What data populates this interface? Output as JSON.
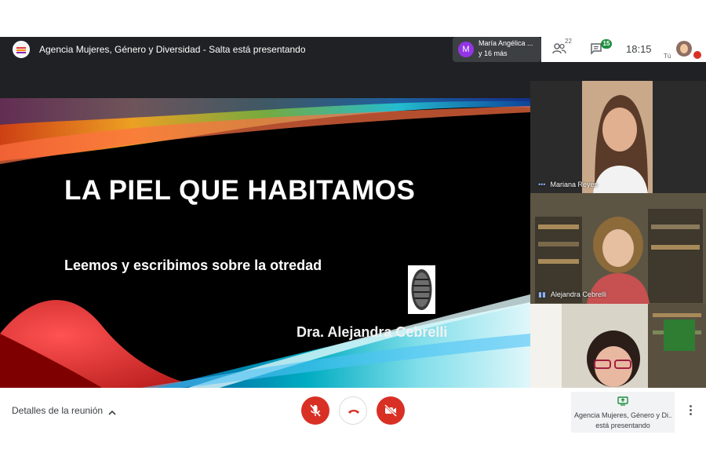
{
  "header": {
    "presenter_text": "Agencia Mujeres, Género y Diversidad - Salta está presentando",
    "join_notice": {
      "avatar_letter": "M",
      "name": "María Angélica ...",
      "more": "y 16 más"
    },
    "people_count": "22",
    "chat_badge": "15",
    "time": "18:15",
    "self_label": "Tú"
  },
  "slide": {
    "title": "LA PIEL QUE HABITAMOS",
    "subtitle": "Leemos y escribimos sobre la otredad",
    "author": "Dra. Alejandra Cebrelli"
  },
  "participants": [
    {
      "name": "Mariana Reyes"
    },
    {
      "name": "Alejandra Cebrelli"
    },
    {
      "name": ""
    }
  ],
  "footer": {
    "details_label": "Detalles de la reunión",
    "present_line1": "Agencia Mujeres, Género y Di...",
    "present_line2": "está presentando"
  },
  "colors": {
    "mute_red": "#d93025",
    "accent_green": "#1e8e3e",
    "join_purple": "#9334e6",
    "dark_bg": "#202124"
  }
}
